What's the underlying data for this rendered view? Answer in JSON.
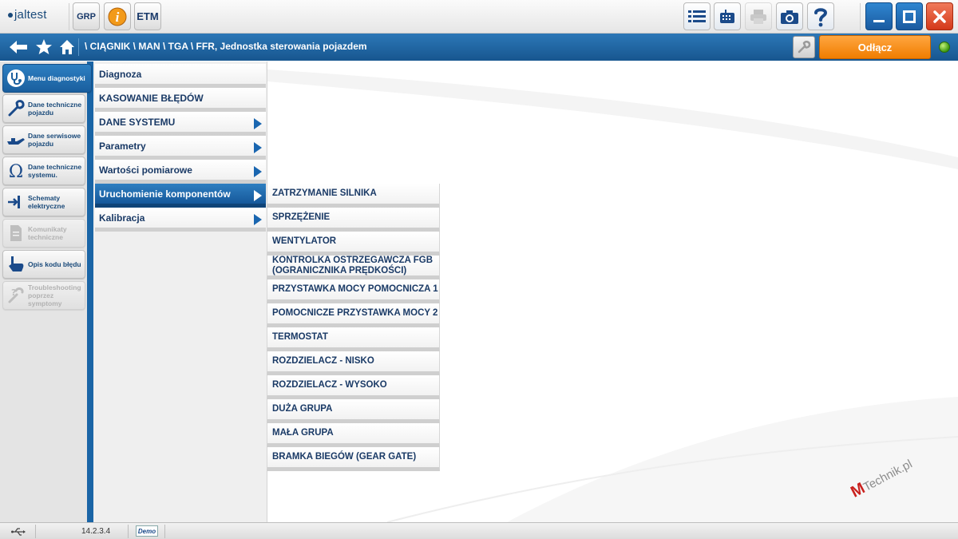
{
  "app": {
    "logo_text": "jaltest",
    "toolbar": {
      "grp_label": "GRP",
      "info_label": "i",
      "etm_label": "ETM"
    }
  },
  "navbar": {
    "breadcrumb": "\\ CIĄGNIK \\ MAN \\ TGA \\ FFR, Jednostka sterowania pojazdem",
    "disconnect_label": "Odłącz"
  },
  "sidebar": {
    "items": [
      {
        "label": "Menu diagnostyki",
        "icon": "stethoscope-icon",
        "state": "active"
      },
      {
        "label": "Dane techniczne pojazdu",
        "icon": "wrench-icon",
        "state": "normal"
      },
      {
        "label": "Dane serwisowe pojazdu",
        "icon": "oil-can-icon",
        "state": "normal"
      },
      {
        "label": "Dane techniczne systemu.",
        "icon": "omega-icon",
        "state": "normal"
      },
      {
        "label": "Schematy elektryczne",
        "icon": "circuit-icon",
        "state": "normal"
      },
      {
        "label": "Komunikaty techniczne",
        "icon": "document-icon",
        "state": "disabled"
      },
      {
        "label": "Opis kodu błędu",
        "icon": "hand-pointer-icon",
        "state": "normal"
      },
      {
        "label": "Troubleshooting poprzez symptomy",
        "icon": "tools-icon",
        "state": "disabled"
      }
    ]
  },
  "menu": {
    "items": [
      {
        "label": "Diagnoza",
        "has_submenu": false
      },
      {
        "label": "KASOWANIE BŁĘDÓW",
        "has_submenu": false
      },
      {
        "label": "DANE SYSTEMU",
        "has_submenu": true
      },
      {
        "label": "Parametry",
        "has_submenu": true
      },
      {
        "label": "Wartości pomiarowe",
        "has_submenu": true
      },
      {
        "label": "Uruchomienie komponentów",
        "has_submenu": true,
        "selected": true
      },
      {
        "label": "Kalibracja",
        "has_submenu": true
      }
    ]
  },
  "submenu": {
    "items": [
      "ZATRZYMANIE SILNIKA",
      "SPRZĘŻENIE",
      "WENTYLATOR",
      "KONTROLKA OSTRZEGAWCZA FGB (OGRANICZNIKA PRĘDKOŚCI)",
      "PRZYSTAWKA MOCY POMOCNICZA 1",
      "POMOCNICZE PRZYSTAWKA MOCY 2",
      "TERMOSTAT",
      "ROZDZIELACZ - NISKO",
      "ROZDZIELACZ - WYSOKO",
      "DUŻA GRUPA",
      "MAŁA GRUPA",
      "BRAMKA BIEGÓW (GEAR GATE)"
    ]
  },
  "statusbar": {
    "version": "14.2.3.4",
    "mode": "Demo"
  },
  "watermark": {
    "brand_m": "M",
    "brand_rest": "Technik.pl"
  },
  "colors": {
    "accent_blue": "#1a65a6",
    "disconnect_orange": "#f07d00",
    "close_red": "#d4391a",
    "status_green": "#3e9a10"
  }
}
